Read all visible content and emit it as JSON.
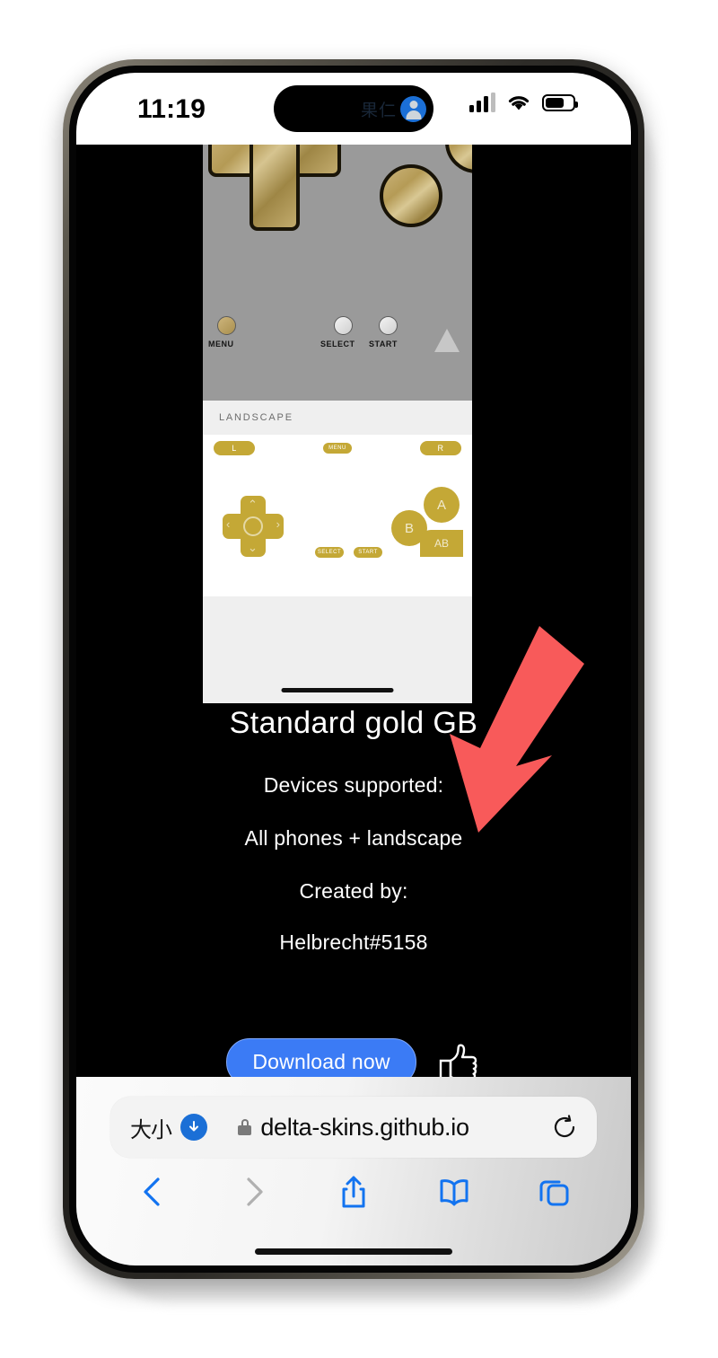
{
  "status_bar": {
    "time": "11:19",
    "dynamic_island_text": "果仁",
    "avatar_icon": "person-circle-icon",
    "signal_icon": "cellular-signal-icon",
    "wifi_icon": "wifi-icon",
    "battery_icon": "battery-icon",
    "battery_level_pct": 70
  },
  "webpage": {
    "skin_title": "Standard gold GB",
    "devices_label": "Devices supported:",
    "devices_value": "All phones + landscape",
    "creator_label": "Created by:",
    "creator_value": "Helbrecht#5158",
    "download_label": "Download now",
    "thumbs_icon": "thumbs-up-icon"
  },
  "skin_preview": {
    "portrait": {
      "menu_label": "MENU",
      "select_label": "SELECT",
      "start_label": "START",
      "logo_icon": "triangle-logo-icon"
    },
    "landscape": {
      "section_label": "LANDSCAPE",
      "l_label": "L",
      "r_label": "R",
      "menu_label": "MENU",
      "select_label": "SELECT",
      "start_label": "START",
      "a_label": "A",
      "b_label": "B",
      "ab_label": "AB",
      "dpad_up": "⌃",
      "dpad_down": "⌄",
      "dpad_left": "‹",
      "dpad_right": "›"
    },
    "gold_color": "#c4a836",
    "metal_gold": "#b49a55"
  },
  "annotation": {
    "arrow_icon": "red-down-left-arrow-icon",
    "arrow_color": "#F85A5A"
  },
  "safari": {
    "text_size_label": "大小",
    "download_indicator_icon": "download-arrow-icon",
    "lock_icon": "lock-icon",
    "url": "delta-skins.github.io",
    "reload_icon": "reload-icon",
    "back_icon": "chevron-left-icon",
    "forward_icon": "chevron-right-icon",
    "share_icon": "share-icon",
    "bookmarks_icon": "book-icon",
    "tabs_icon": "tabs-icon",
    "back_enabled_color": "#1273f0",
    "forward_disabled_color": "#b0b0b0"
  }
}
